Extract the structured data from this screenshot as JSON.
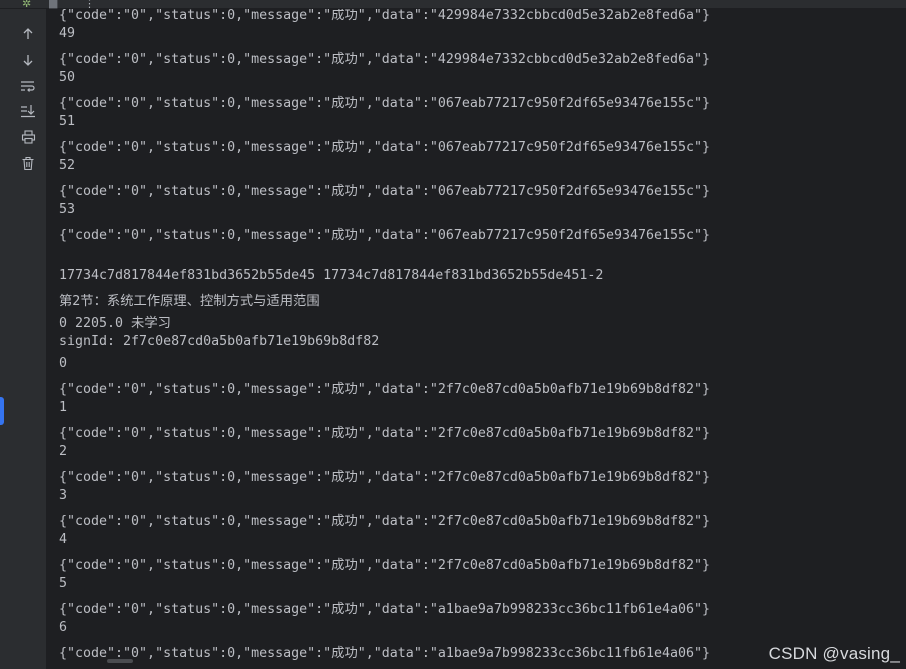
{
  "toolbar": {
    "top_icons": [
      "bug-icon",
      "stop-icon",
      "more-icon"
    ],
    "tools": [
      {
        "name": "scroll-up-icon",
        "glyph": "↑"
      },
      {
        "name": "scroll-down-icon",
        "glyph": "↓"
      },
      {
        "name": "soft-wrap-icon",
        "glyph": "wrap"
      },
      {
        "name": "scroll-to-end-icon",
        "glyph": "end"
      },
      {
        "name": "print-icon",
        "glyph": "print"
      },
      {
        "name": "trash-icon",
        "glyph": "trash"
      }
    ]
  },
  "console": {
    "lines": [
      "{\"code\":\"0\",\"status\":0,\"message\":\"成功\",\"data\":\"429984e7332cbbcd0d5e32ab2e8fed6a\"}",
      "49",
      "{\"code\":\"0\",\"status\":0,\"message\":\"成功\",\"data\":\"429984e7332cbbcd0d5e32ab2e8fed6a\"}",
      "50",
      "{\"code\":\"0\",\"status\":0,\"message\":\"成功\",\"data\":\"067eab77217c950f2df65e93476e155c\"}",
      "51",
      "{\"code\":\"0\",\"status\":0,\"message\":\"成功\",\"data\":\"067eab77217c950f2df65e93476e155c\"}",
      "52",
      "{\"code\":\"0\",\"status\":0,\"message\":\"成功\",\"data\":\"067eab77217c950f2df65e93476e155c\"}",
      "53",
      "{\"code\":\"0\",\"status\":0,\"message\":\"成功\",\"data\":\"067eab77217c950f2df65e93476e155c\"}",
      "",
      "17734c7d817844ef831bd3652b55de45 17734c7d817844ef831bd3652b55de451-2",
      "第2节：系统工作原理、控制方式与适用范围",
      "0 2205.0 未学习",
      "signId: 2f7c0e87cd0a5b0afb71e19b69b8df82",
      "0",
      "{\"code\":\"0\",\"status\":0,\"message\":\"成功\",\"data\":\"2f7c0e87cd0a5b0afb71e19b69b8df82\"}",
      "1",
      "{\"code\":\"0\",\"status\":0,\"message\":\"成功\",\"data\":\"2f7c0e87cd0a5b0afb71e19b69b8df82\"}",
      "2",
      "{\"code\":\"0\",\"status\":0,\"message\":\"成功\",\"data\":\"2f7c0e87cd0a5b0afb71e19b69b8df82\"}",
      "3",
      "{\"code\":\"0\",\"status\":0,\"message\":\"成功\",\"data\":\"2f7c0e87cd0a5b0afb71e19b69b8df82\"}",
      "4",
      "{\"code\":\"0\",\"status\":0,\"message\":\"成功\",\"data\":\"2f7c0e87cd0a5b0afb71e19b69b8df82\"}",
      "5",
      "{\"code\":\"0\",\"status\":0,\"message\":\"成功\",\"data\":\"a1bae9a7b998233cc36bc11fb61e4a06\"}",
      "6",
      "{\"code\":\"0\",\"status\":0,\"message\":\"成功\",\"data\":\"a1bae9a7b998233cc36bc11fb61e4a06\"}"
    ]
  },
  "watermark": "CSDN @vasing_",
  "colors": {
    "console_bg": "#1e1f22",
    "panel_bg": "#2b2d30",
    "text": "#bcbec4",
    "accent": "#3574f0"
  }
}
